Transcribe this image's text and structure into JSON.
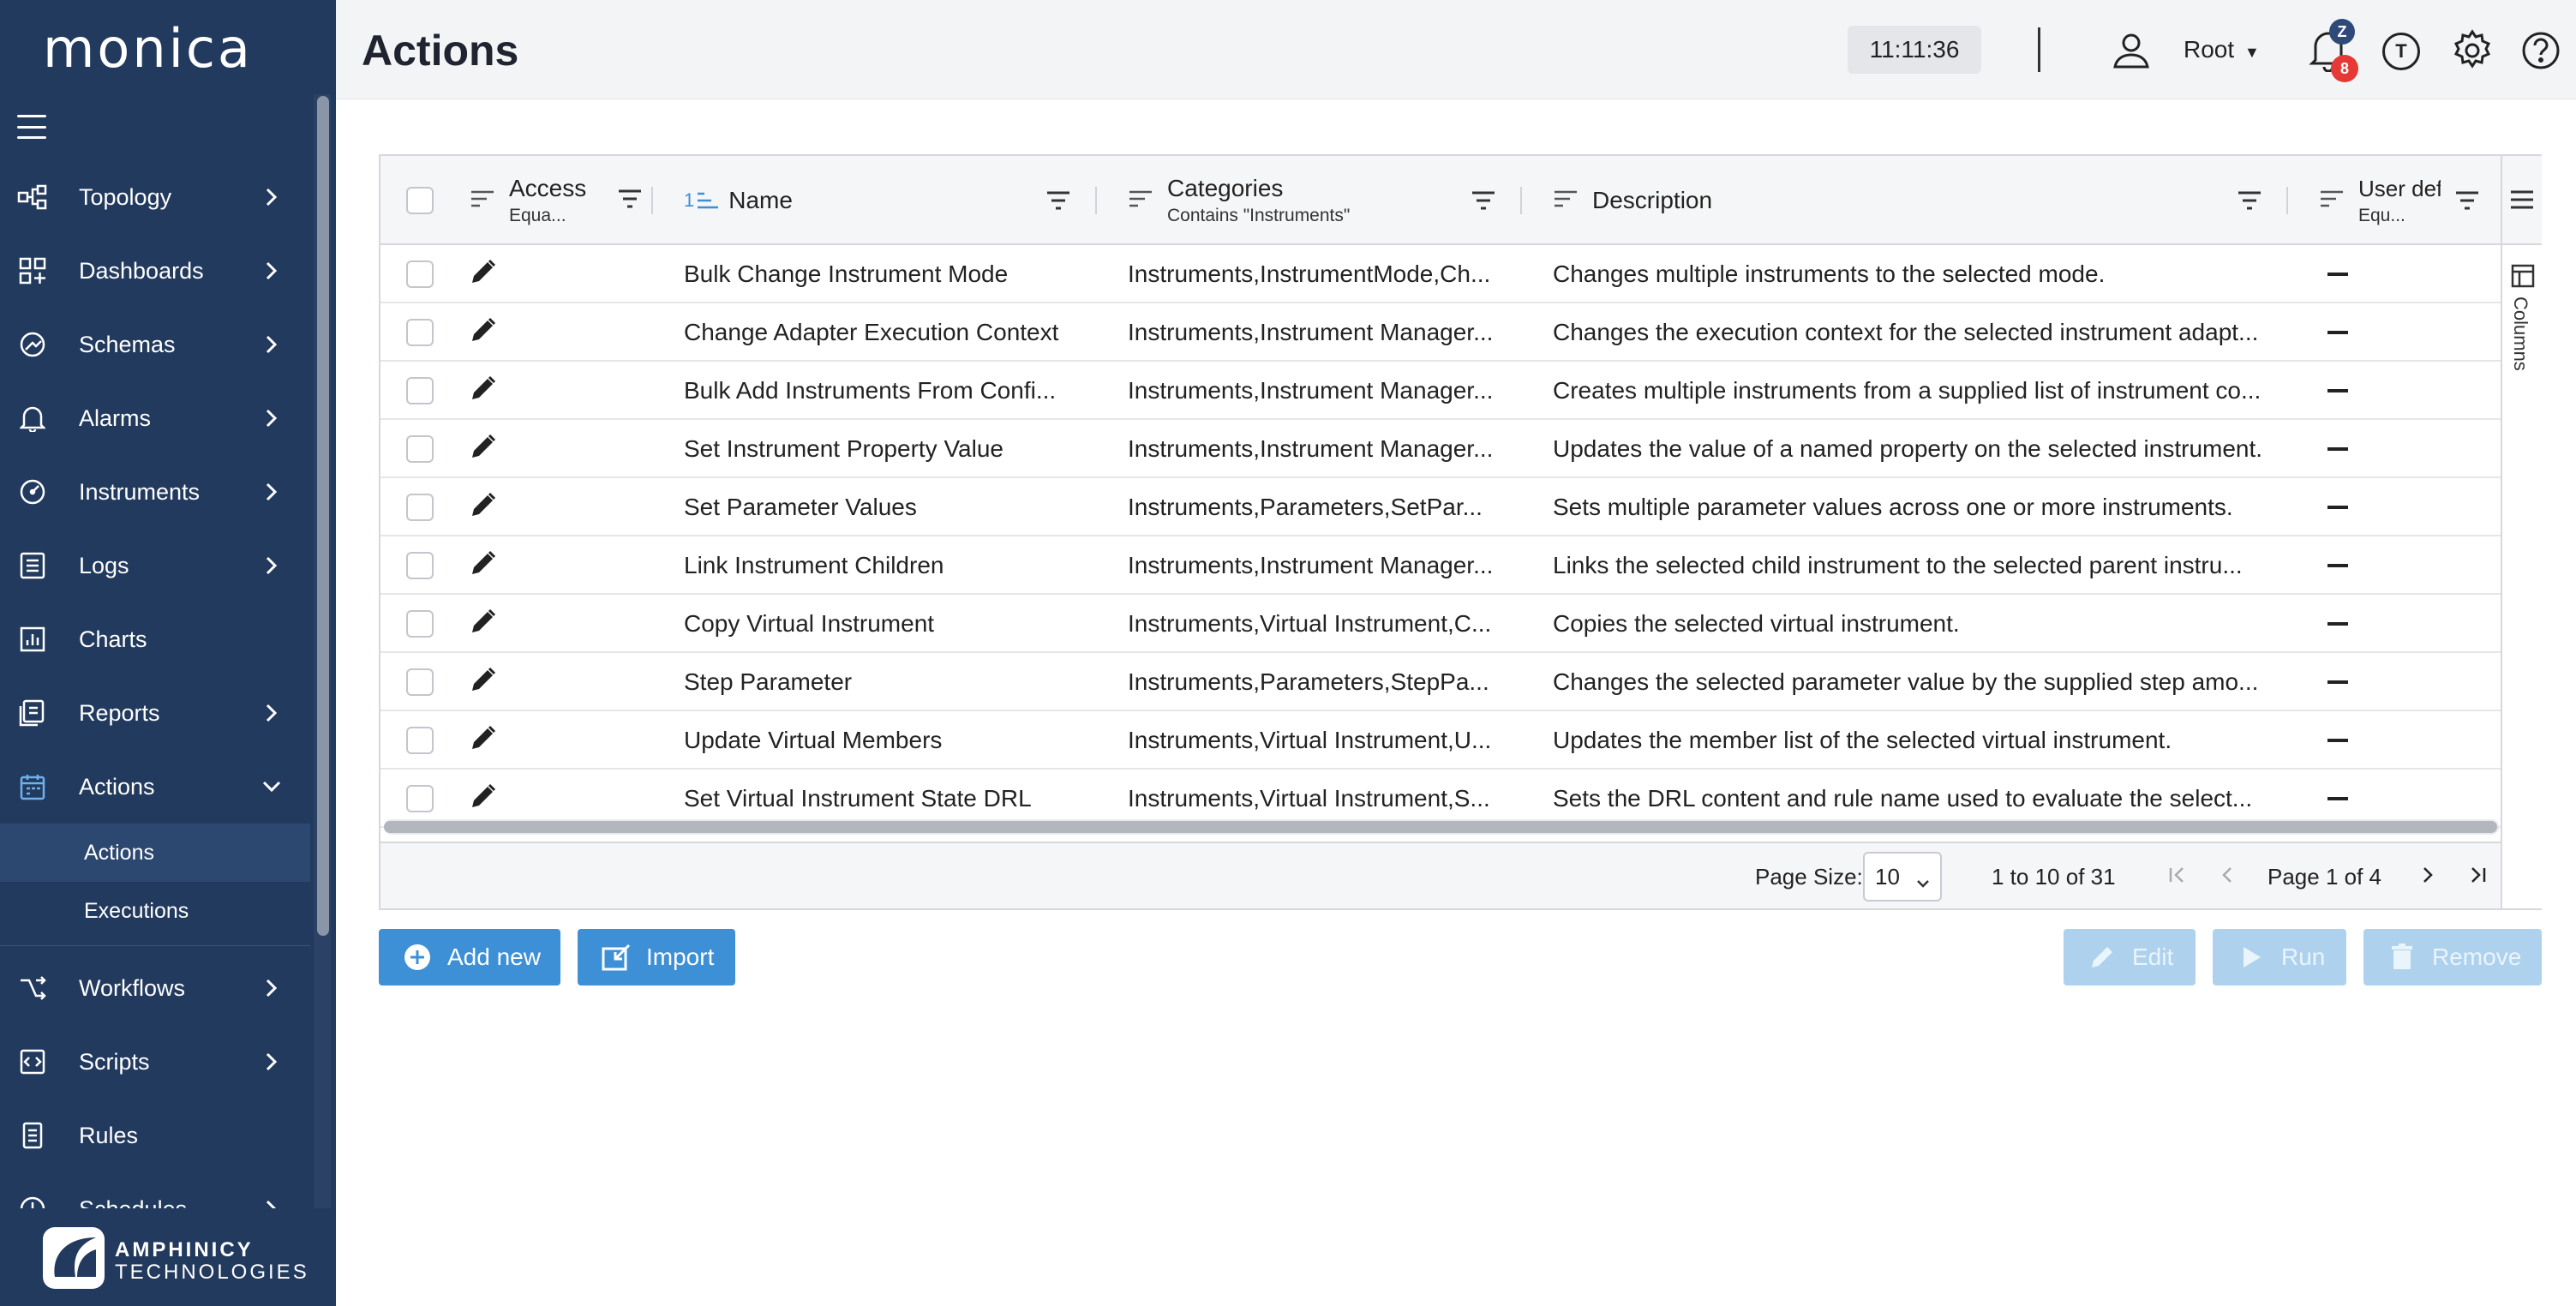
{
  "sidebar": {
    "logo": "monica",
    "items": [
      {
        "label": "Topology",
        "icon": "topology-icon"
      },
      {
        "label": "Dashboards",
        "icon": "dashboard-icon"
      },
      {
        "label": "Schemas",
        "icon": "schema-icon"
      },
      {
        "label": "Alarms",
        "icon": "bell-icon"
      },
      {
        "label": "Instruments",
        "icon": "gauge-icon"
      },
      {
        "label": "Logs",
        "icon": "log-icon"
      },
      {
        "label": "Charts",
        "icon": "chart-icon"
      },
      {
        "label": "Reports",
        "icon": "report-icon"
      },
      {
        "label": "Actions",
        "icon": "calendar-icon"
      },
      {
        "label": "Workflows",
        "icon": "workflow-icon"
      },
      {
        "label": "Scripts",
        "icon": "code-icon"
      },
      {
        "label": "Rules",
        "icon": "rules-icon"
      },
      {
        "label": "Schedules",
        "icon": "schedule-icon"
      }
    ],
    "sub_items": [
      {
        "label": "Actions"
      },
      {
        "label": "Executions"
      }
    ],
    "footer": {
      "brand_line1": "AMPHINICY",
      "brand_line2": "TECHNOLOGIES"
    }
  },
  "header": {
    "title": "Actions",
    "clock": "11:11:36",
    "user": "Root",
    "badge_user": "Z",
    "badge_count": "8",
    "t_label": "T"
  },
  "grid": {
    "columns": [
      {
        "label": "Access",
        "sub": "Equa..."
      },
      {
        "label": "Name",
        "sort": "1"
      },
      {
        "label": "Categories",
        "sub": "Contains \"Instruments\""
      },
      {
        "label": "Description"
      },
      {
        "label": "User def",
        "sub": "Equ..."
      }
    ],
    "rows": [
      {
        "name": "Bulk Change Instrument Mode",
        "categories": "Instruments,InstrumentMode,Ch...",
        "description": "Changes multiple instruments to the selected mode."
      },
      {
        "name": "Change Adapter Execution Context",
        "categories": "Instruments,Instrument Manager...",
        "description": "Changes the execution context for the selected instrument adapt..."
      },
      {
        "name": "Bulk Add Instruments From Confi...",
        "categories": "Instruments,Instrument Manager...",
        "description": "Creates multiple instruments from a supplied list of instrument co..."
      },
      {
        "name": "Set Instrument Property Value",
        "categories": "Instruments,Instrument Manager...",
        "description": "Updates the value of a named property on the selected instrument."
      },
      {
        "name": "Set Parameter Values",
        "categories": "Instruments,Parameters,SetPar...",
        "description": "Sets multiple parameter values across one or more instruments."
      },
      {
        "name": "Link Instrument Children",
        "categories": "Instruments,Instrument Manager...",
        "description": "Links the selected child instrument to the selected parent instru..."
      },
      {
        "name": "Copy Virtual Instrument",
        "categories": "Instruments,Virtual Instrument,C...",
        "description": "Copies the selected virtual instrument."
      },
      {
        "name": "Step Parameter",
        "categories": "Instruments,Parameters,StepPa...",
        "description": "Changes the selected parameter value by the supplied step amo..."
      },
      {
        "name": "Update Virtual Members",
        "categories": "Instruments,Virtual Instrument,U...",
        "description": "Updates the member list of the selected virtual instrument."
      },
      {
        "name": "Set Virtual Instrument State DRL",
        "categories": "Instruments,Virtual Instrument,S...",
        "description": "Sets the DRL content and rule name used to evaluate the select..."
      }
    ],
    "side_panel_label": "Columns",
    "pager": {
      "page_size_label": "Page Size:",
      "page_size": "10",
      "range": "1 to 10 of 31",
      "page_info": "Page 1 of 4"
    }
  },
  "buttons": {
    "add_new": "Add new",
    "import": "Import",
    "edit": "Edit",
    "run": "Run",
    "remove": "Remove"
  },
  "colors": {
    "sidebar_bg": "#223a5e",
    "primary": "#3d8fd6",
    "disabled": "#aed2ee",
    "badge_red": "#e53935"
  }
}
